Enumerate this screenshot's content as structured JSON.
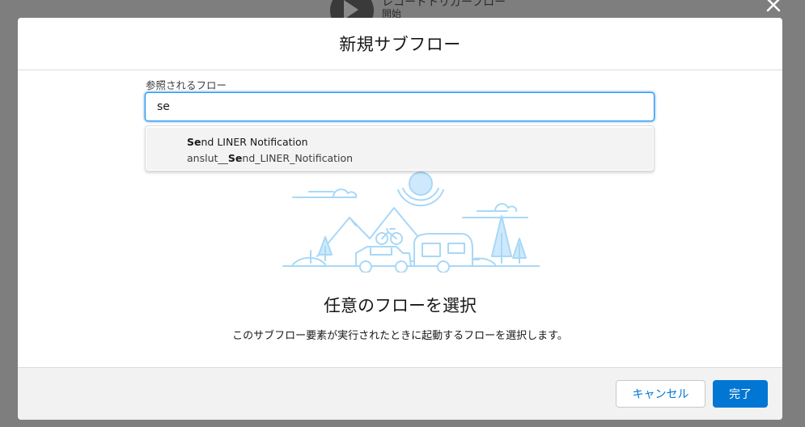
{
  "background": {
    "node_title": "レコードトリガーフロー",
    "node_subtitle": "開始"
  },
  "modal": {
    "title": "新規サブフロー",
    "field_label": "参照されるフロー",
    "search_value": "se",
    "dropdown": {
      "option": {
        "label_match": "Se",
        "label_rest": "nd LINER Notification",
        "api_prefix": "anslut__",
        "api_match": "Se",
        "api_rest": "nd_LINER_Notification"
      }
    },
    "empty_state": {
      "title": "任意のフローを選択",
      "description": "このサブフロー要素が実行されたときに起動するフローを選択します。"
    },
    "footer": {
      "cancel_label": "キャンセル",
      "done_label": "完了"
    }
  },
  "colors": {
    "brand": "#0176d3",
    "illustration": "#a8d8f7"
  },
  "icons": [
    "close-icon",
    "play-icon"
  ]
}
